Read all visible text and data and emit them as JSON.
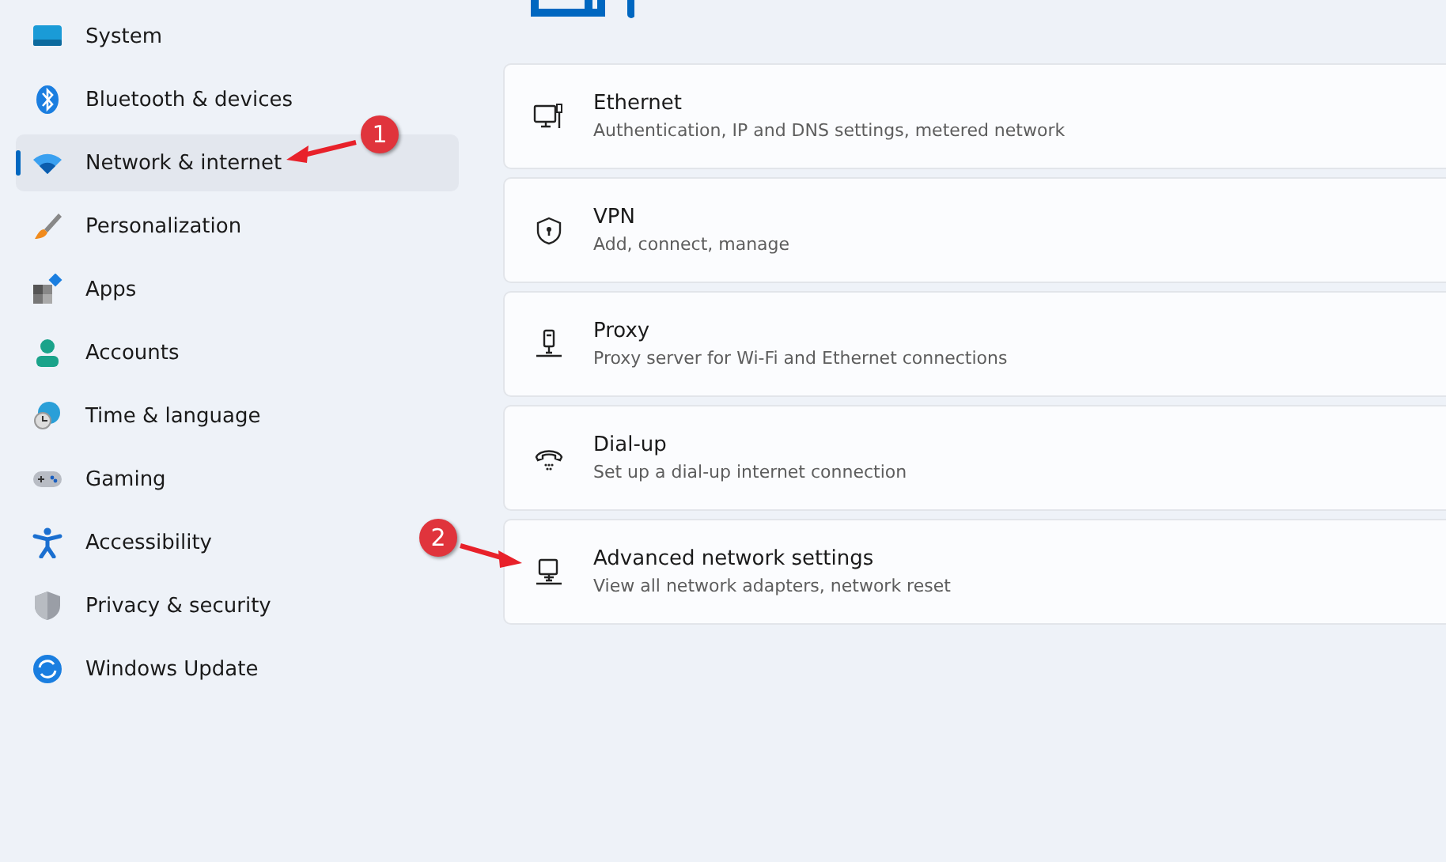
{
  "sidebar": {
    "items": [
      {
        "label": "System",
        "selected": false
      },
      {
        "label": "Bluetooth & devices",
        "selected": false
      },
      {
        "label": "Network & internet",
        "selected": true
      },
      {
        "label": "Personalization",
        "selected": false
      },
      {
        "label": "Apps",
        "selected": false
      },
      {
        "label": "Accounts",
        "selected": false
      },
      {
        "label": "Time & language",
        "selected": false
      },
      {
        "label": "Gaming",
        "selected": false
      },
      {
        "label": "Accessibility",
        "selected": false
      },
      {
        "label": "Privacy & security",
        "selected": false
      },
      {
        "label": "Windows Update",
        "selected": false
      }
    ]
  },
  "settings": [
    {
      "title": "Ethernet",
      "description": "Authentication, IP and DNS settings, metered network"
    },
    {
      "title": "VPN",
      "description": "Add, connect, manage"
    },
    {
      "title": "Proxy",
      "description": "Proxy server for Wi-Fi and Ethernet connections"
    },
    {
      "title": "Dial-up",
      "description": "Set up a dial-up internet connection"
    },
    {
      "title": "Advanced network settings",
      "description": "View all network adapters, network reset"
    }
  ],
  "annotations": [
    {
      "number": "1"
    },
    {
      "number": "2"
    }
  ]
}
